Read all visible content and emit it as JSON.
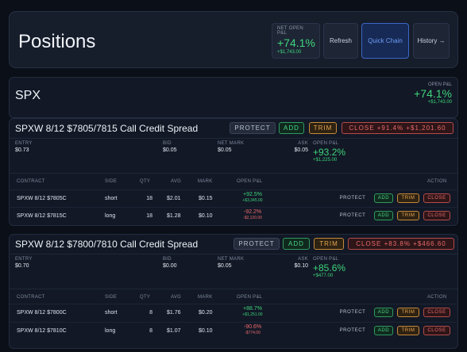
{
  "header": {
    "title": "Positions",
    "pnl_label": "NET OPEN P&L",
    "pnl_pct": "+74.1%",
    "pnl_amt": "+$1,743.00",
    "refresh": "Refresh",
    "quick_chain": "Quick Chain",
    "history": "History →"
  },
  "underlying": {
    "symbol": "SPX",
    "pnl_label": "OPEN P&L",
    "pnl_pct": "+74.1%",
    "pnl_amt": "+$1,743.00"
  },
  "positions": [
    {
      "title": "SPXW 8/12 $7805/7815 Call Credit Spread",
      "protect": "PROTECT",
      "add": "ADD",
      "trim": "TRIM",
      "close": "CLOSE +91.4% +$1,201.60",
      "entry_label": "ENTRY",
      "entry": "$0.73",
      "bid_label": "BID",
      "bid": "$0.05",
      "mark_label": "NET MARK",
      "mark": "$0.05",
      "ask_label": "ASK",
      "ask": "$0.05",
      "pnl_label": "OPEN P&L",
      "pnl_pct": "+93.2%",
      "pnl_amt": "+$1,225.00",
      "legs": [
        {
          "contract": "SPXW 8/12 $7805C",
          "side": "short",
          "qty": "18",
          "avg": "$2.01",
          "mark": "$0.15",
          "pct": "+92.5%",
          "amt": "+$3,345.00",
          "pos": true
        },
        {
          "contract": "SPXW 8/12 $7815C",
          "side": "long",
          "qty": "18",
          "avg": "$1.28",
          "mark": "$0.10",
          "pct": "-92.2%",
          "amt": "-$2,120.00",
          "pos": false
        }
      ]
    },
    {
      "title": "SPXW 8/12 $7800/7810 Call Credit Spread",
      "protect": "PROTECT",
      "add": "ADD",
      "trim": "TRIM",
      "close": "CLOSE +83.8% +$466.60",
      "entry_label": "ENTRY",
      "entry": "$0.70",
      "bid_label": "BID",
      "bid": "$0.00",
      "mark_label": "NET MARK",
      "mark": "$0.05",
      "ask_label": "ASK",
      "ask": "$0.10",
      "pnl_label": "OPEN P&L",
      "pnl_pct": "+85.6%",
      "pnl_amt": "+$477.00",
      "legs": [
        {
          "contract": "SPXW 8/12 $7800C",
          "side": "short",
          "qty": "8",
          "avg": "$1.76",
          "mark": "$0.20",
          "pct": "+88.7%",
          "amt": "+$1,251.00",
          "pos": true
        },
        {
          "contract": "SPXW 8/12 $7810C",
          "side": "long",
          "qty": "8",
          "avg": "$1.07",
          "mark": "$0.10",
          "pct": "-90.6%",
          "amt": "-$774.00",
          "pos": false
        }
      ]
    }
  ],
  "columns": {
    "contract": "CONTRACT",
    "side": "SIDE",
    "qty": "QTY",
    "avg": "AVG",
    "mark": "MARK",
    "open_pnl": "OPEN P&L",
    "action": "ACTION"
  },
  "row_actions": {
    "protect": "PROTECT",
    "add": "ADD",
    "trim": "TRIM",
    "close": "CLOSE"
  },
  "colors": {
    "positive": "#3fd47a",
    "negative": "#ec6a6a",
    "accent": "#3d66c8"
  }
}
